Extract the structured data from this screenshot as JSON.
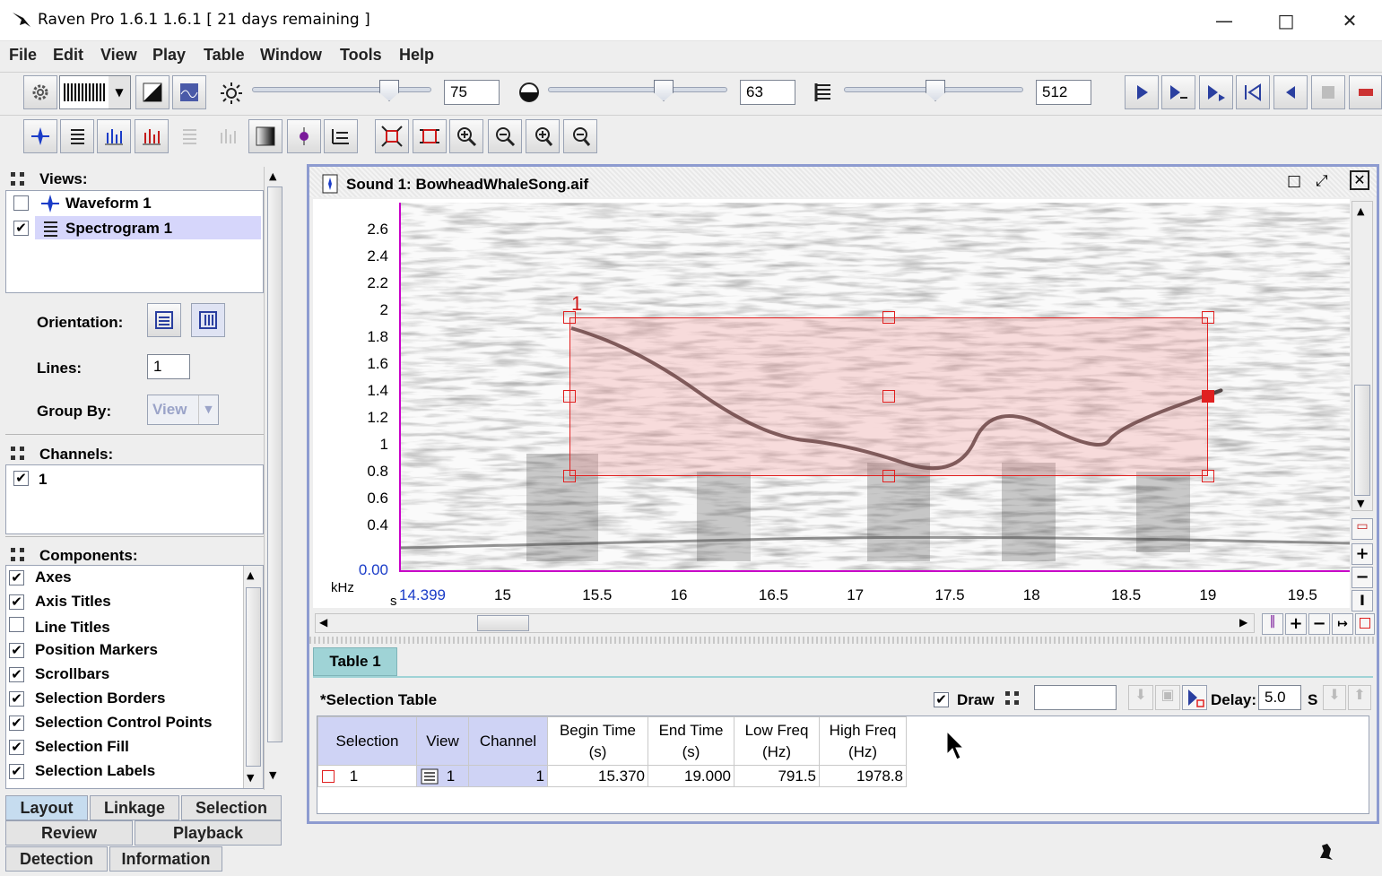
{
  "app": {
    "title": "Raven Pro 1.6.1 1.6.1  [ 21 days remaining ]"
  },
  "menu": [
    "File",
    "Edit",
    "View",
    "Play",
    "Table",
    "Window",
    "Tools",
    "Help"
  ],
  "toolbar": {
    "brightness": "75",
    "contrast": "63",
    "fft_size": "512"
  },
  "views": {
    "header": "Views:",
    "items": [
      {
        "label": "Waveform 1",
        "checked": false
      },
      {
        "label": "Spectrogram 1",
        "checked": true
      }
    ],
    "orientation_label": "Orientation:",
    "lines_label": "Lines:",
    "lines_value": "1",
    "groupby_label": "Group By:",
    "groupby_value": "View"
  },
  "channels": {
    "header": "Channels:",
    "items": [
      "1"
    ]
  },
  "components": {
    "header": "Components:",
    "items": [
      {
        "label": "Axes",
        "checked": true
      },
      {
        "label": "Axis Titles",
        "checked": true
      },
      {
        "label": "Line Titles",
        "checked": false
      },
      {
        "label": "Position Markers",
        "checked": true
      },
      {
        "label": "Scrollbars",
        "checked": true
      },
      {
        "label": "Selection Borders",
        "checked": true
      },
      {
        "label": "Selection Control Points",
        "checked": true
      },
      {
        "label": "Selection Fill",
        "checked": true
      },
      {
        "label": "Selection Labels",
        "checked": true
      }
    ]
  },
  "bottom_tabs": {
    "row1": [
      "Layout",
      "Linkage",
      "Selection"
    ],
    "row2": [
      "Review",
      "Playback"
    ],
    "row3": [
      "Detection",
      "Information"
    ]
  },
  "sound_window": {
    "title": "Sound 1: BowheadWhaleSong.aif"
  },
  "spectrogram": {
    "y_ticks": [
      "2.6",
      "2.4",
      "2.2",
      "2",
      "1.8",
      "1.6",
      "1.4",
      "1.2",
      "1",
      "0.8",
      "0.6",
      "0.4",
      "0.00"
    ],
    "y_unit": "kHz",
    "x_unit": "s",
    "x_start": "14.399",
    "x_ticks": [
      "15",
      "15.5",
      "16",
      "16.5",
      "17",
      "17.5",
      "18",
      "18.5",
      "19",
      "19.5"
    ],
    "selection_label": "1"
  },
  "table_tab": "Table 1",
  "selection_table": {
    "title": "*Selection Table",
    "draw_label": "Draw",
    "draw_checked": true,
    "delay_label": "Delay:",
    "delay_value": "5.0",
    "delay_unit": "S",
    "columns": [
      "Selection",
      "View",
      "Channel",
      "Begin Time (s)",
      "End Time (s)",
      "Low Freq (Hz)",
      "High Freq (Hz)"
    ],
    "rows": [
      {
        "selection": "1",
        "view": "1",
        "channel": "1",
        "begin": "15.370",
        "end": "19.000",
        "low": "791.5",
        "high": "1978.8"
      }
    ]
  }
}
